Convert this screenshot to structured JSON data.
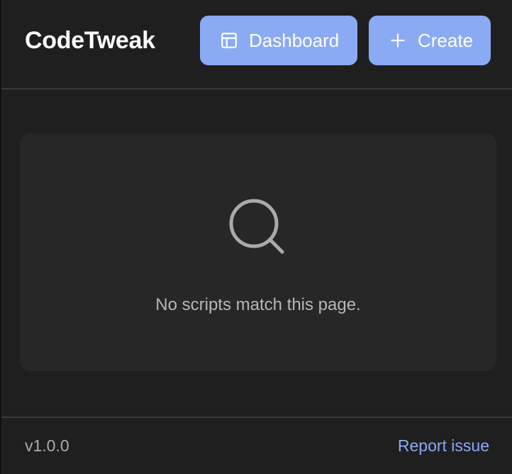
{
  "header": {
    "title": "CodeTweak",
    "dashboard_label": "Dashboard",
    "dashboard_icon": "layout-icon",
    "create_label": "Create",
    "create_icon": "plus-icon"
  },
  "empty_state": {
    "icon": "search-icon",
    "message": "No scripts match this page."
  },
  "footer": {
    "version": "v1.0.0",
    "report_label": "Report issue"
  },
  "colors": {
    "background": "#1f1f1f",
    "card": "#272727",
    "accent": "#8aaaf3",
    "divider": "#3b3b3b",
    "muted_text": "#b7b7b7"
  }
}
